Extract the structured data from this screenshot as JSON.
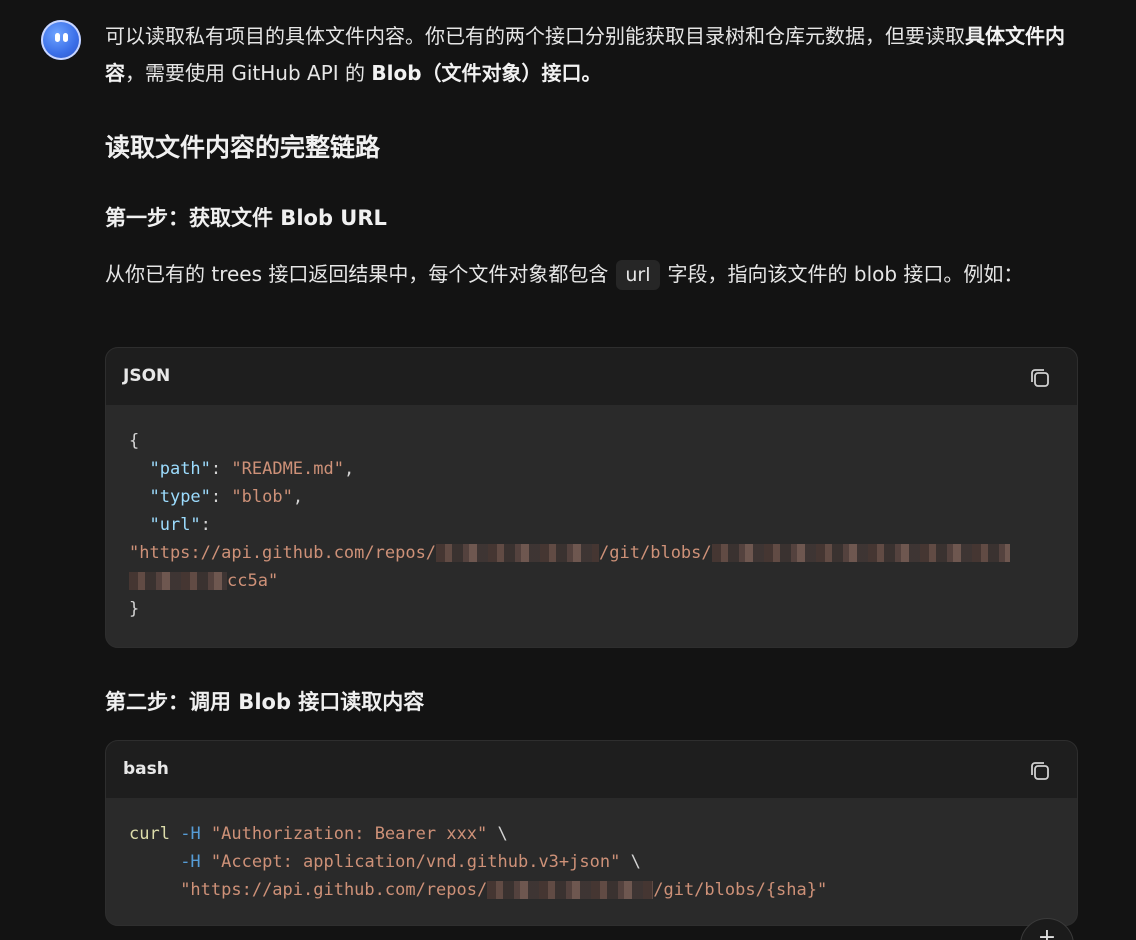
{
  "message": {
    "intro_part1": "可以读取私有项目的具体文件内容。你已有的两个接口分别能获取目录树和仓库元数据，但要读取",
    "intro_bold1": "具体文件内容",
    "intro_part2": "，需要使用 GitHub API 的 ",
    "intro_bold2": "Blob（文件对象）接口。",
    "section_title": "读取文件内容的完整链路",
    "step1_title": "第一步：获取文件 Blob URL",
    "step1_text_a": "从你已有的 trees 接口返回结果中，每个文件对象都包含",
    "step1_code": "url",
    "step1_text_b": "字段，指向该文件的 blob 接口。例如：",
    "step2_title": "第二步：调用 Blob 接口读取内容"
  },
  "code_blocks": [
    {
      "lang": "JSON",
      "lines": {
        "l1": "{",
        "path_key": "\"path\"",
        "path_val": "\"README.md\"",
        "type_key": "\"type\"",
        "type_val": "\"blob\"",
        "url_key": "\"url\"",
        "url_start": "\"https://api.github.com/repos/",
        "url_mid": "/git/blobs/",
        "url_end": "cc5a\"",
        "l_end": "}"
      }
    },
    {
      "lang": "bash",
      "lines": {
        "cmd": "curl",
        "flag1": "-H",
        "hdr1": "\"Authorization: Bearer xxx\"",
        "flag2": "-H",
        "hdr2": "\"Accept: application/vnd.github.v3+json\"",
        "url_start": "\"https://api.github.com/repos/",
        "url_end": "/git/blobs/{sha}\""
      }
    }
  ],
  "icons": {
    "avatar": "assistant-avatar",
    "copy": "copy-icon",
    "fab": "plus-icon"
  },
  "fab_label": "+"
}
